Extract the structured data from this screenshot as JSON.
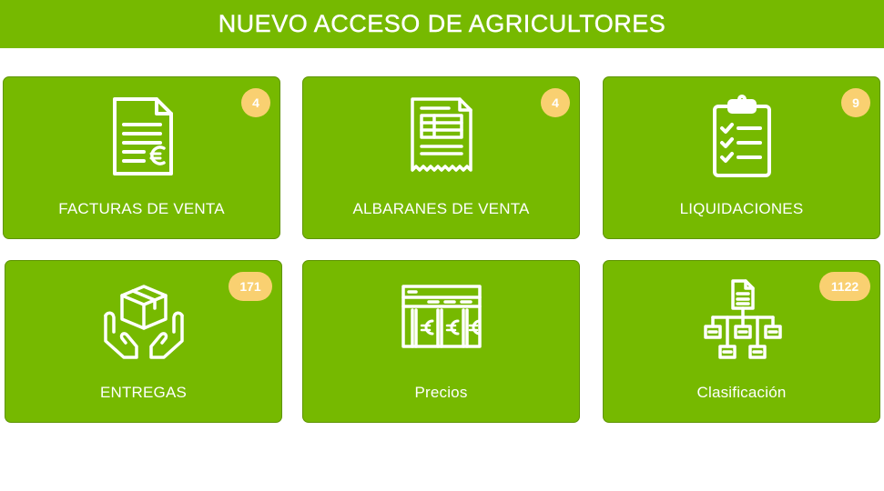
{
  "header": {
    "title": "NUEVO ACCESO DE AGRICULTORES"
  },
  "tiles": [
    {
      "label": "FACTURAS DE VENTA",
      "badge": "4",
      "icon": "invoice-euro-icon"
    },
    {
      "label": "ALBARANES DE VENTA",
      "badge": "4",
      "icon": "delivery-note-receipt-icon"
    },
    {
      "label": "LIQUIDACIONES",
      "badge": "9",
      "icon": "clipboard-checklist-icon"
    },
    {
      "label": "ENTREGAS",
      "badge": "171",
      "icon": "box-hands-icon"
    },
    {
      "label": "Precios",
      "icon": "price-table-euro-icon"
    },
    {
      "label": "Clasificación",
      "badge": "1122",
      "icon": "hierarchy-document-icon"
    }
  ],
  "colors": {
    "primary": "#76b900",
    "badge": "#f9d071",
    "text": "#ffffff"
  }
}
